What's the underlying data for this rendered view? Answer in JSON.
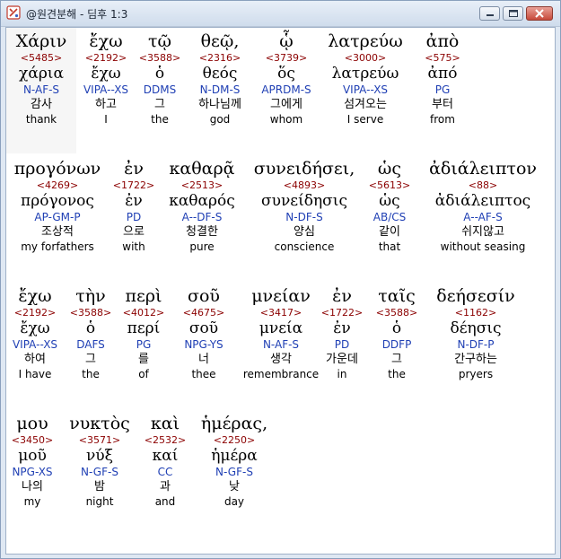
{
  "window": {
    "title": "@원견분해 - 딤후 1:3"
  },
  "verse": [
    {
      "greek": "Χάριν",
      "strong": "<5485>",
      "lemma": "χάρια",
      "parse": "N-AF-S",
      "korean": "감사",
      "english": "thank"
    },
    {
      "greek": "ἔχω",
      "strong": "<2192>",
      "lemma": "ἔχω",
      "parse": "VIPA--XS",
      "korean": "하고",
      "english": "I"
    },
    {
      "greek": "τῷ",
      "strong": "<3588>",
      "lemma": "ὁ",
      "parse": "DDMS",
      "korean": "그",
      "english": "the"
    },
    {
      "greek": "θεῷ,",
      "strong": "<2316>",
      "lemma": "θεός",
      "parse": "N-DM-S",
      "korean": "하나님께",
      "english": "god"
    },
    {
      "greek": "ᾧ",
      "strong": "<3739>",
      "lemma": "ὅς",
      "parse": "APRDM-S",
      "korean": "그에게",
      "english": "whom"
    },
    {
      "greek": "λατρεύω",
      "strong": "<3000>",
      "lemma": "λατρεύω",
      "parse": "VIPA--XS",
      "korean": "섬겨오는",
      "english": "I serve"
    },
    {
      "greek": "ἀπὸ",
      "strong": "<575>",
      "lemma": "ἀπό",
      "parse": "PG",
      "korean": "부터",
      "english": "from"
    },
    {
      "greek": "προγόνων",
      "strong": "<4269>",
      "lemma": "πρόγονος",
      "parse": "AP-GM-P",
      "korean": "조상적",
      "english": "my forfathers"
    },
    {
      "greek": "ἐν",
      "strong": "<1722>",
      "lemma": "ἐν",
      "parse": "PD",
      "korean": "으로",
      "english": "with"
    },
    {
      "greek": "καθαρᾷ",
      "strong": "<2513>",
      "lemma": "καθαρός",
      "parse": "A--DF-S",
      "korean": "청결한",
      "english": "pure"
    },
    {
      "greek": "συνειδήσει,",
      "strong": "<4893>",
      "lemma": "συνείδησις",
      "parse": "N-DF-S",
      "korean": "양심",
      "english": "conscience"
    },
    {
      "greek": "ὡς",
      "strong": "<5613>",
      "lemma": "ὡς",
      "parse": "AB/CS",
      "korean": "같이",
      "english": "that"
    },
    {
      "greek": "ἀδιάλειπτον",
      "strong": "<88>",
      "lemma": "ἀδιάλειπτος",
      "parse": "A--AF-S",
      "korean": "쉬지않고",
      "english": "without seasing"
    },
    {
      "greek": "ἔχω",
      "strong": "<2192>",
      "lemma": "ἔχω",
      "parse": "VIPA--XS",
      "korean": "하여",
      "english": "I have"
    },
    {
      "greek": "τὴν",
      "strong": "<3588>",
      "lemma": "ὁ",
      "parse": "DAFS",
      "korean": "그",
      "english": "the"
    },
    {
      "greek": "περὶ",
      "strong": "<4012>",
      "lemma": "περί",
      "parse": "PG",
      "korean": "를",
      "english": "of"
    },
    {
      "greek": "σοῦ",
      "strong": "<4675>",
      "lemma": "σοῦ",
      "parse": "NPG-YS",
      "korean": "너",
      "english": "thee"
    },
    {
      "greek": "μνείαν",
      "strong": "<3417>",
      "lemma": "μνεία",
      "parse": "N-AF-S",
      "korean": "생각",
      "english": "remembrance"
    },
    {
      "greek": "ἐν",
      "strong": "<1722>",
      "lemma": "ἐν",
      "parse": "PD",
      "korean": "가운데",
      "english": "in"
    },
    {
      "greek": "ταῖς",
      "strong": "<3588>",
      "lemma": "ὁ",
      "parse": "DDFP",
      "korean": "그",
      "english": "the"
    },
    {
      "greek": "δεήσεσίν",
      "strong": "<1162>",
      "lemma": "δέησις",
      "parse": "N-DF-P",
      "korean": "간구하는",
      "english": "pryers"
    },
    {
      "greek": "μου",
      "strong": "<3450>",
      "lemma": "μοῦ",
      "parse": "NPG-XS",
      "korean": "나의",
      "english": "my"
    },
    {
      "greek": "νυκτὸς",
      "strong": "<3571>",
      "lemma": "νύξ",
      "parse": "N-GF-S",
      "korean": "밤",
      "english": "night"
    },
    {
      "greek": "καὶ",
      "strong": "<2532>",
      "lemma": "καί",
      "parse": "CC",
      "korean": "과",
      "english": "and"
    },
    {
      "greek": "ἡμέρας,",
      "strong": "<2250>",
      "lemma": "ἡμέρα",
      "parse": "N-GF-S",
      "korean": "낮",
      "english": "day"
    }
  ],
  "colors": {
    "strong": "#8b0000",
    "parse": "#1f3fb4",
    "selected_bg": "#f6f6f6"
  },
  "icons": {
    "app": "interlinear-app-icon",
    "minimize": "minimize-icon",
    "maximize": "maximize-icon",
    "close": "close-icon"
  }
}
